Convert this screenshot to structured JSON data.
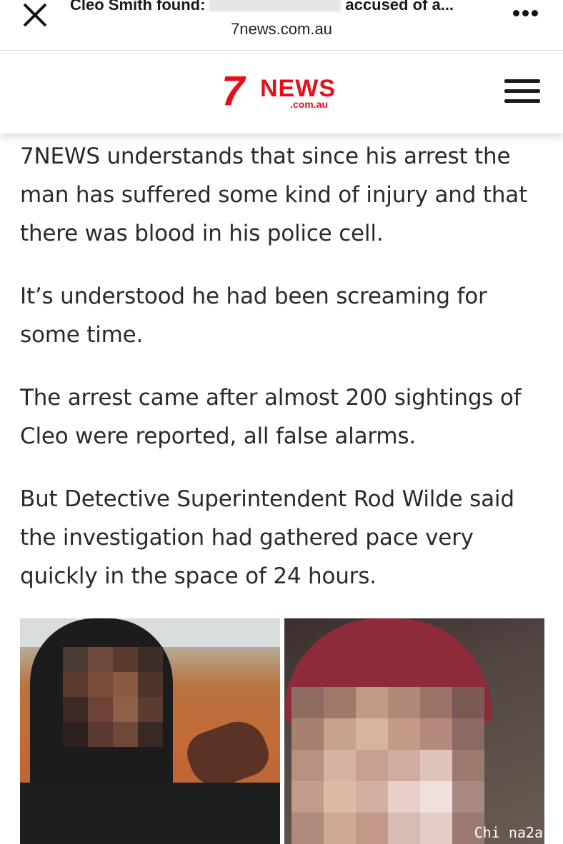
{
  "browser": {
    "tab_title_start": "Cleo Smith found:",
    "tab_title_end": "accused of a...",
    "url": "7news.com.au"
  },
  "site": {
    "logo_seven": "7",
    "logo_news": "NEWS",
    "logo_domain": ".com.au",
    "brand_color": "#e3101b"
  },
  "article": {
    "paragraphs": [
      "7NEWS understands that since his arrest the man has suffered some kind of injury and that there was blood in his police cell.",
      "It’s understood he had been screaming for some time.",
      "The arrest came after almost 200 sightings of Cleo were reported, all false alarms.",
      "But Detective Superintendent Rod Wilde said the investigation had gathered pace very quickly in the space of 24 hours."
    ]
  },
  "watermark": "Chi na2a",
  "icons": {
    "close": "close-icon",
    "more": "more-options-icon",
    "menu": "hamburger-menu-icon"
  }
}
